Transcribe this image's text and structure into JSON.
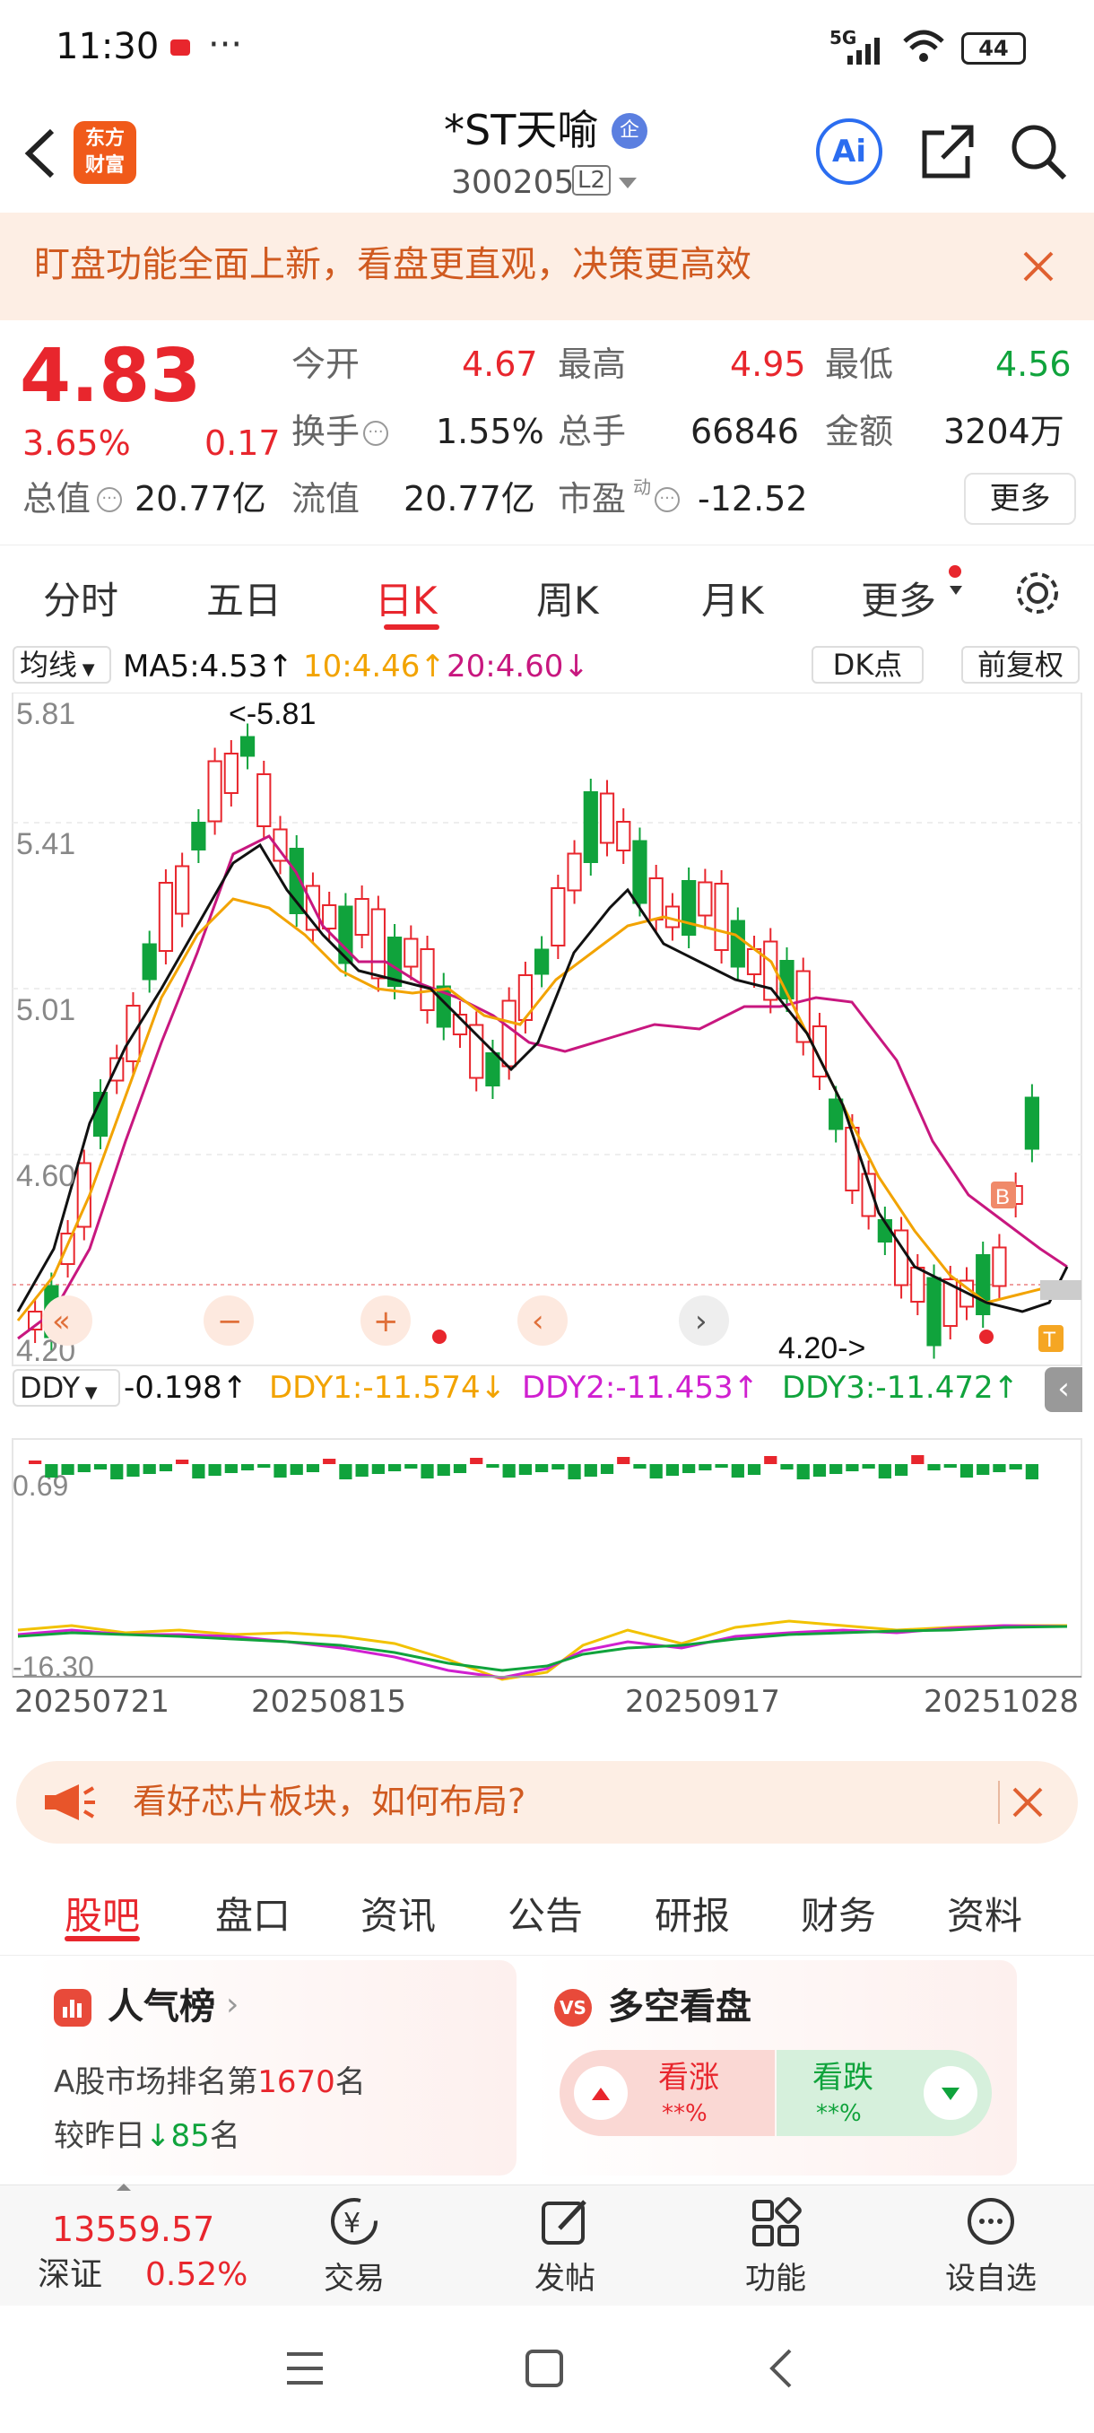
{
  "status": {
    "time": "11:30",
    "dots": "···",
    "net": "5G",
    "battery": "44"
  },
  "header": {
    "logo_line1": "东方",
    "logo_line2": "财富",
    "title": "*ST天喻",
    "badge": "企",
    "code": "300205",
    "level": "L2",
    "ai": "Ai"
  },
  "banner": {
    "text": "盯盘功能全面上新，看盘更直观，决策更高效"
  },
  "quote": {
    "price": "4.83",
    "pct": "3.65%",
    "change": "0.17",
    "open_label": "今开",
    "open": "4.67",
    "high_label": "最高",
    "high": "4.95",
    "low_label": "最低",
    "low": "4.56",
    "turnover_label": "换手",
    "turnover": "1.55%",
    "volume_label": "总手",
    "volume": "66846",
    "amount_label": "金额",
    "amount": "3204万",
    "mktcap_label": "总值",
    "mktcap": "20.77亿",
    "float_label": "流值",
    "float": "20.77亿",
    "pe_label": "市盈",
    "pe_sup": "动",
    "pe": "-12.52",
    "more": "更多"
  },
  "tabs": [
    "分时",
    "五日",
    "日K",
    "周K",
    "月K",
    "更多"
  ],
  "chart_controls": {
    "ma_select": "均线",
    "ma5": "MA5:4.53↑",
    "ma10": "10:4.46↑",
    "ma20": "20:4.60↓",
    "dk": "DK点",
    "adj": "前复权"
  },
  "price_axis": {
    "top": "5.81",
    "l2": "5.41",
    "l3": "5.01",
    "l4": "4.60",
    "bottom": "4.20",
    "max_note": "<-5.81",
    "min_note": "4.20->"
  },
  "indicator": {
    "name": "DDY",
    "ddy": "-0.198↑",
    "ddy1": "DDY1:-11.574↓",
    "ddy2": "DDY2:-11.453↑",
    "ddy3": "DDY3:-11.472↑",
    "top": "0.69",
    "bottom": "-16.30"
  },
  "dates": [
    "20250721",
    "20250815",
    "20250917",
    "20251028"
  ],
  "markers": {
    "b": "B",
    "t": "T"
  },
  "chart_data": {
    "type": "candlestick",
    "price_range": [
      4.2,
      5.81
    ],
    "ma5_last": 4.53,
    "ma10_last": 4.46,
    "ma20_last": 4.6,
    "high_marker": 5.81,
    "low_marker": 4.2,
    "indicator_range": [
      -16.3,
      0.69
    ]
  },
  "colors": {
    "up": "#e8262d",
    "down": "#10a33c",
    "ma5": "#111111",
    "ma10": "#f2a300",
    "ma20": "#c8177f",
    "accent": "#e8262d"
  },
  "ad": {
    "text": "看好芯片板块，如何布局?"
  },
  "subtabs": [
    "股吧",
    "盘口",
    "资讯",
    "公告",
    "研报",
    "财务",
    "资料"
  ],
  "popularity": {
    "title": "人气榜",
    "rank_prefix": "A股市场排名第",
    "rank": "1670",
    "rank_suffix": "名",
    "change_prefix": "较昨日",
    "change": "85",
    "change_suffix": "名"
  },
  "bullbear": {
    "title": "多空看盘",
    "up_label": "看涨",
    "up_value": "**%",
    "down_label": "看跌",
    "down_value": "**%"
  },
  "bottom": {
    "index_value": "13559.57",
    "index_name": "深证",
    "index_pct": "0.52%",
    "trade": "交易",
    "post": "发帖",
    "func": "功能",
    "watch": "设自选"
  }
}
